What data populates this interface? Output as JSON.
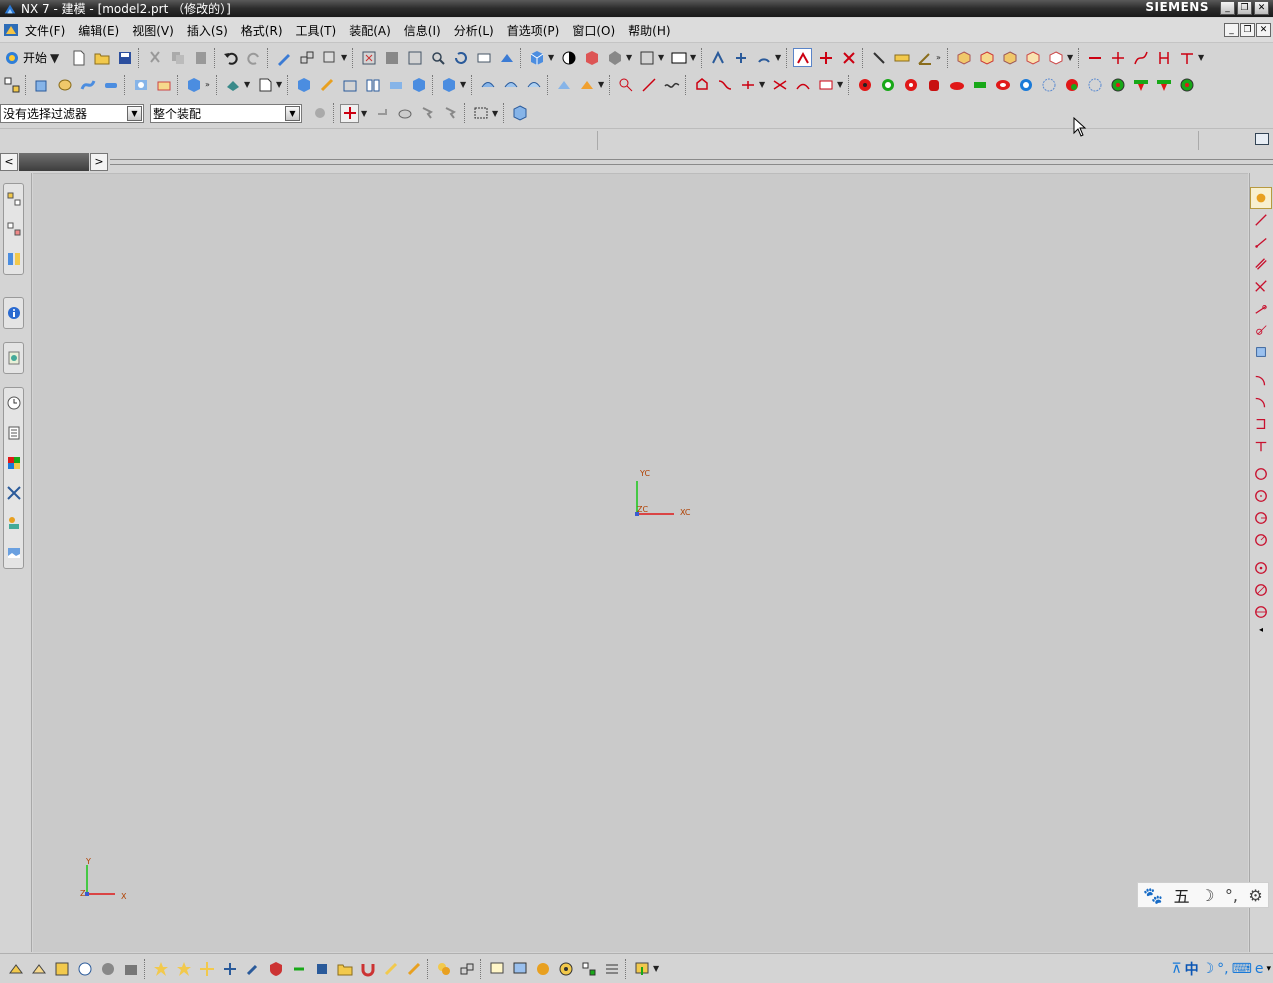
{
  "window": {
    "title": "NX 7 - 建模 - [model2.prt （修改的）]",
    "brand": "SIEMENS",
    "controls": [
      "_",
      "❐",
      "✕"
    ]
  },
  "menu": {
    "items": [
      "文件(F)",
      "编辑(E)",
      "视图(V)",
      "插入(S)",
      "格式(R)",
      "工具(T)",
      "装配(A)",
      "信息(I)",
      "分析(L)",
      "首选项(P)",
      "窗口(O)",
      "帮助(H)"
    ]
  },
  "toolbar": {
    "start_label": "开始"
  },
  "selection": {
    "filter_value": "没有选择过滤器",
    "scope_value": "整个装配"
  },
  "viewport": {
    "wcs": {
      "x_label": "XC",
      "y_label": "YC",
      "z_label": "ZC"
    },
    "abs": {
      "x_label": "X",
      "y_label": "Y",
      "z_label": "Z"
    }
  },
  "ime": {
    "mode_char": "五",
    "tray_char": "中"
  },
  "colors": {
    "accent_red": "#e01818",
    "accent_green": "#18a818",
    "curve_red": "#c8102e",
    "canvas": "#cacaca"
  }
}
